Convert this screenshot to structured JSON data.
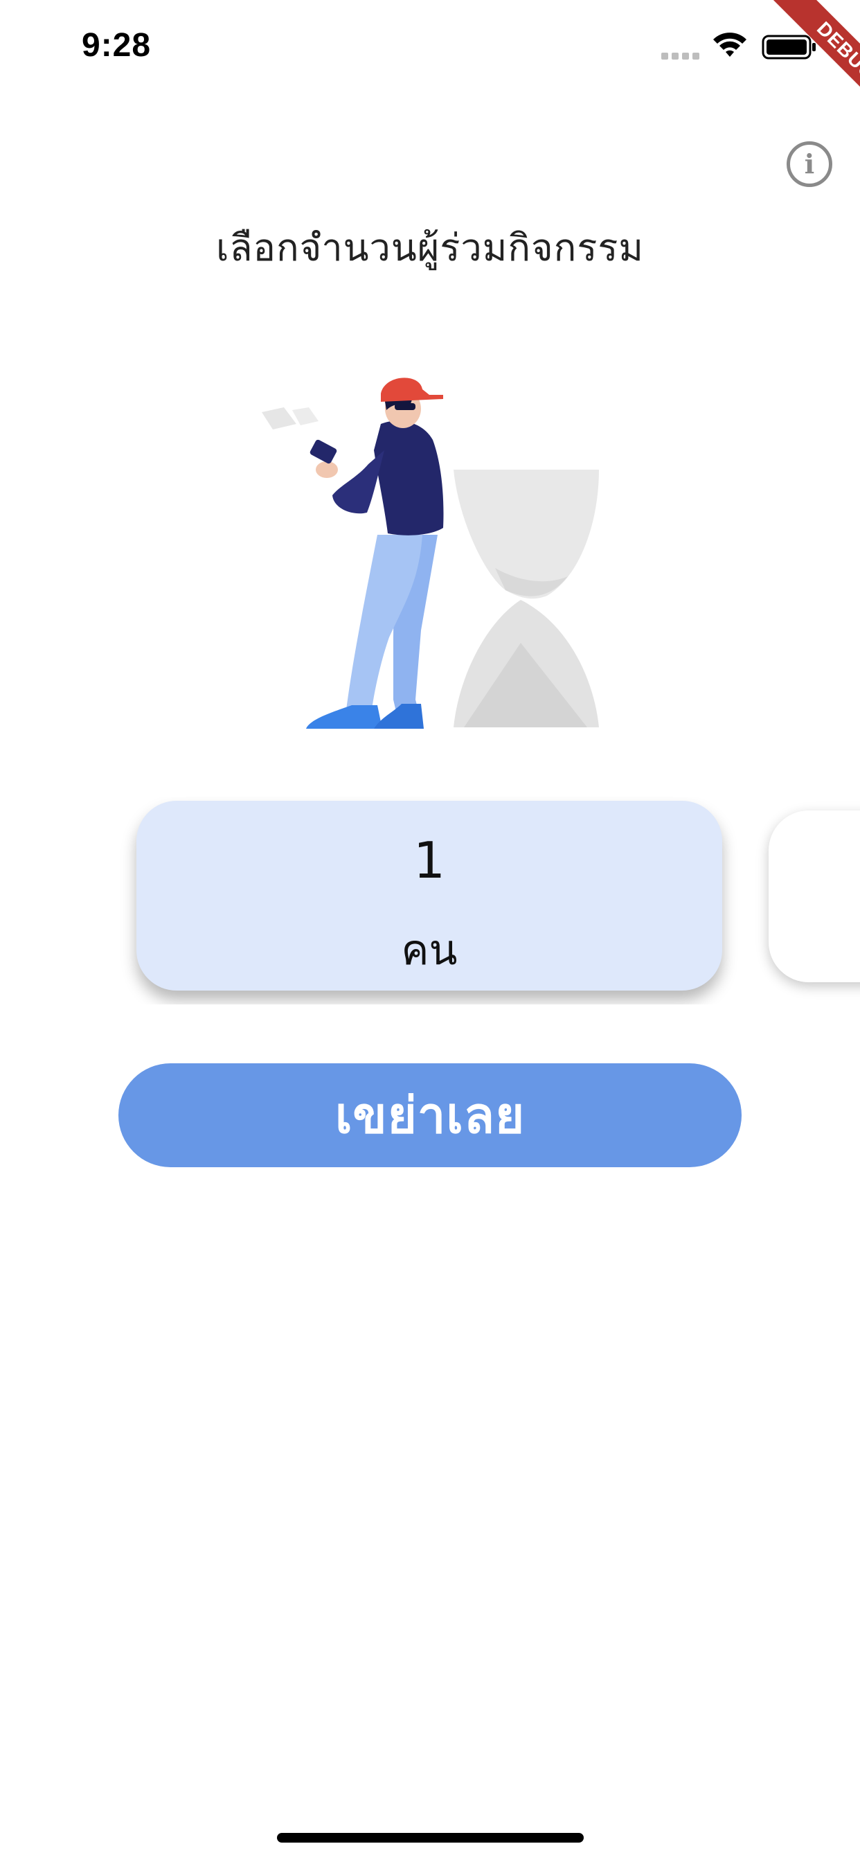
{
  "status_bar": {
    "time": "9:28"
  },
  "debug_banner": {
    "label": "DEBUG"
  },
  "header": {
    "info_icon": "info-icon",
    "info_glyph": "i",
    "title": "เลือกจำนวนผู้ร่วมกิจกรรม"
  },
  "illustration": {
    "icon": "person-with-hourglass-illustration"
  },
  "carousel": {
    "selected": {
      "value": "1",
      "unit": "คน"
    }
  },
  "action": {
    "shake_label": "เขย่าเลย"
  },
  "colors": {
    "background": "#ffffff",
    "selected_card": "#dee8fb",
    "button": "#6797e6",
    "debug_ribbon": "#b8332e"
  }
}
